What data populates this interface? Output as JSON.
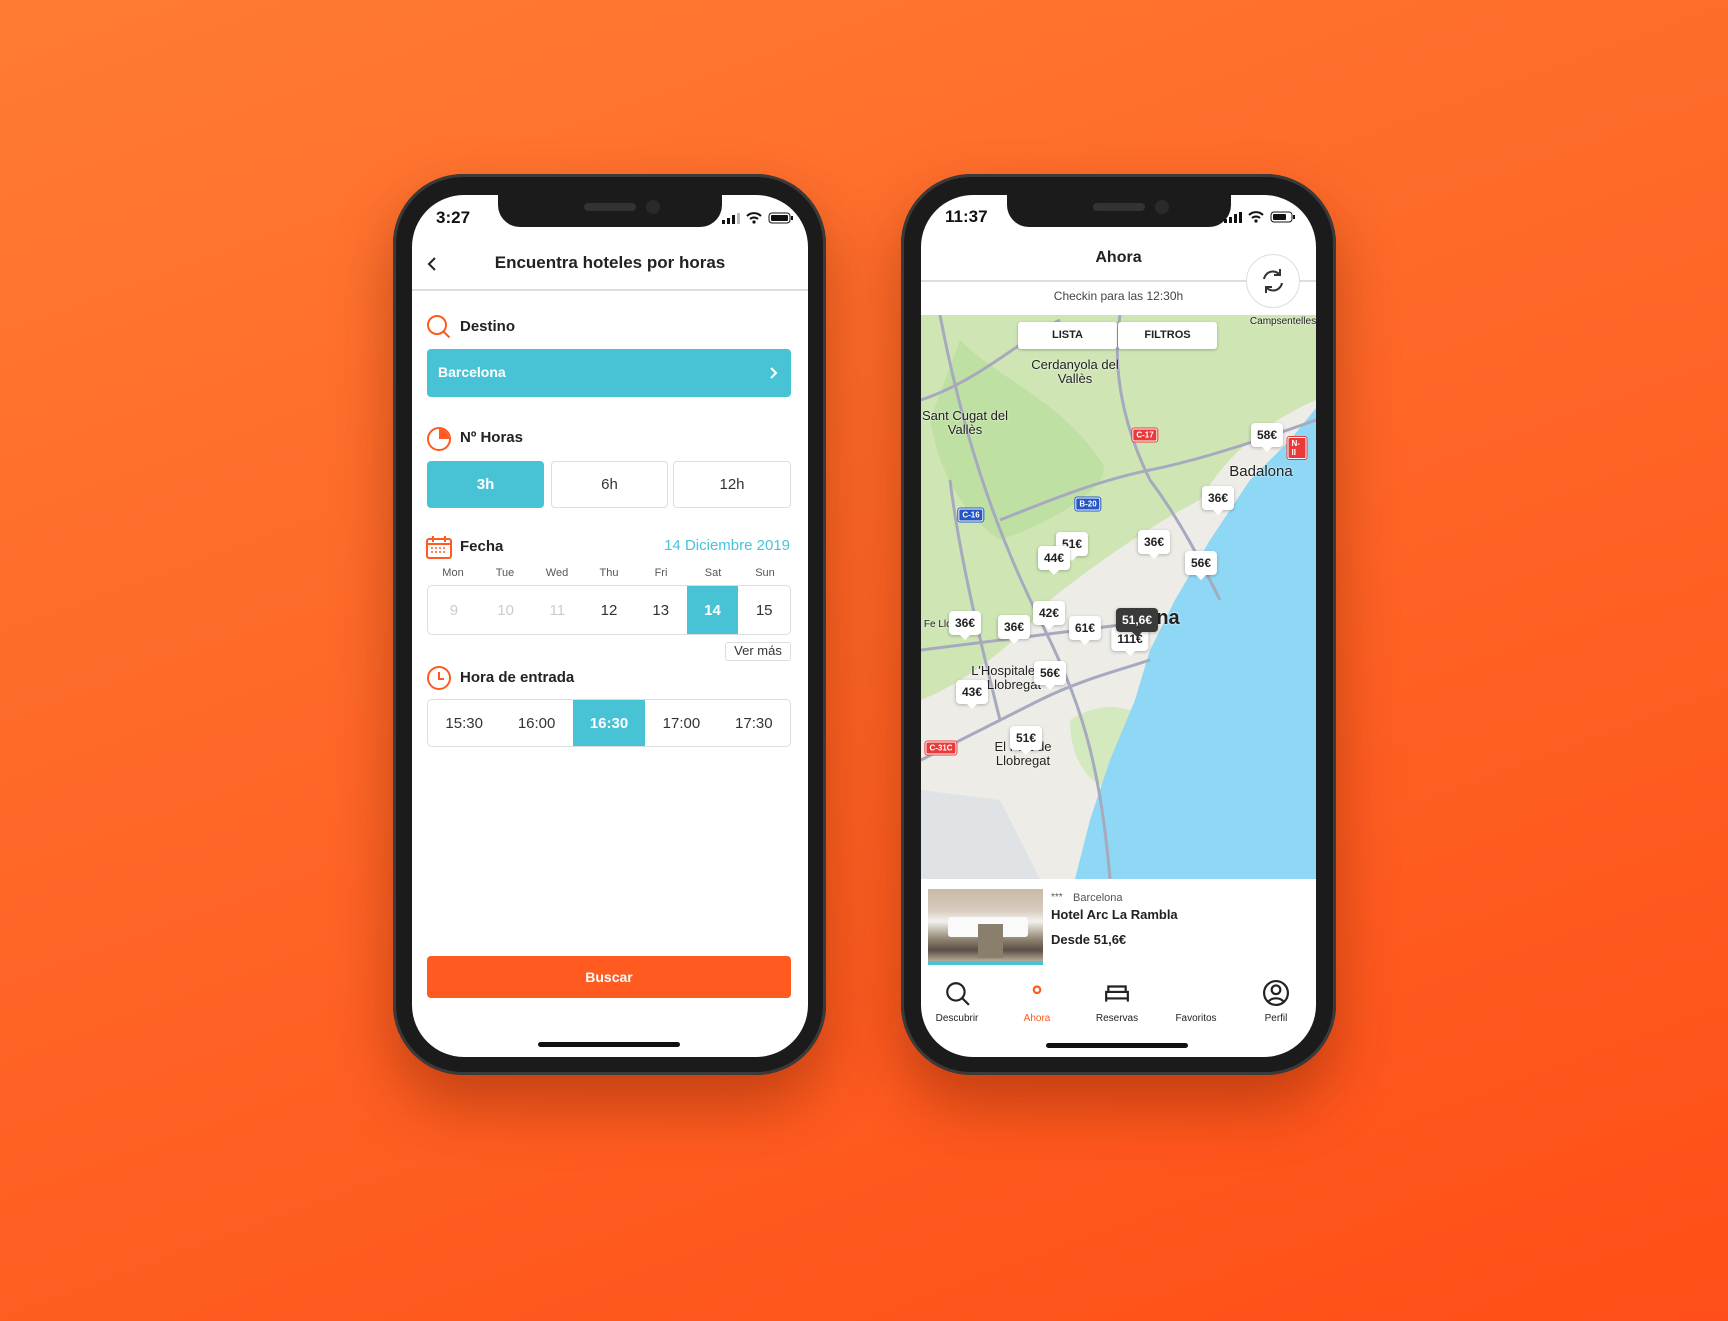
{
  "colors": {
    "accent": "#ff5a1f",
    "teal": "#48c3d6",
    "background": "#ff6526"
  },
  "left": {
    "status": {
      "time": "3:27"
    },
    "header": {
      "title": "Encuentra hoteles por horas",
      "back_icon": "chevron-left-icon"
    },
    "destino": {
      "label": "Destino",
      "value": "Barcelona"
    },
    "horas": {
      "label": "Nº Horas",
      "options": [
        "3h",
        "6h",
        "12h"
      ],
      "selected": "3h"
    },
    "fecha": {
      "label": "Fecha",
      "selected_date": "14 Diciembre 2019",
      "weekdays": [
        "Mon",
        "Tue",
        "Wed",
        "Thu",
        "Fri",
        "Sat",
        "Sun"
      ],
      "days": [
        "9",
        "10",
        "11",
        "12",
        "13",
        "14",
        "15"
      ],
      "disabled": [
        "9",
        "10",
        "11"
      ],
      "selected": "14",
      "more": "Ver más"
    },
    "hora": {
      "label": "Hora de entrada",
      "options": [
        "15:30",
        "16:00",
        "16:30",
        "17:00",
        "17:30"
      ],
      "selected": "16:30"
    },
    "search_button": "Buscar"
  },
  "right": {
    "status": {
      "time": "11:37"
    },
    "header": {
      "title": "Ahora",
      "subtitle": "Checkin para las 12:30h",
      "refresh_icon": "refresh-icon"
    },
    "map": {
      "buttons": [
        "LISTA",
        "FILTROS"
      ],
      "places": [
        "Cerdanyola del Vallès",
        "Sant Cugat del Vallès",
        "Badalona",
        "L'Hospitalet de Llobregat",
        "El Prat de Llobregat",
        "na",
        "Campsentelles",
        "nt Fe Llob"
      ],
      "roads": [
        "C-17",
        "N-II",
        "B-20",
        "C-16",
        "C-31C"
      ],
      "prices": [
        "58€",
        "36€",
        "36€",
        "51€",
        "44€",
        "56€",
        "36€",
        "36€",
        "42€",
        "61€",
        "43€",
        "56€",
        "51€",
        "111€",
        "51,6€"
      ],
      "selected_price": "51,6€"
    },
    "hotel": {
      "stars": "***",
      "city": "Barcelona",
      "name": "Hotel Arc La Rambla",
      "price": "Desde 51,6€"
    },
    "tabs": [
      {
        "label": "Descubrir",
        "icon": "search-icon"
      },
      {
        "label": "Ahora",
        "icon": "location-pin-icon",
        "active": true
      },
      {
        "label": "Reservas",
        "icon": "bed-icon"
      },
      {
        "label": "Favoritos",
        "icon": "heart-icon"
      },
      {
        "label": "Perfil",
        "icon": "user-icon"
      }
    ]
  }
}
